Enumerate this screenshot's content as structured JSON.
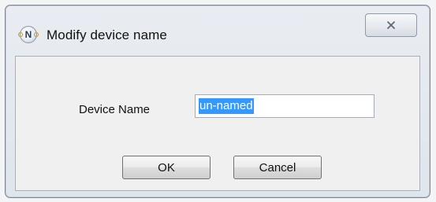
{
  "window": {
    "title": "Modify device name",
    "app_icon": "n-icon",
    "app_icon_letter": "N",
    "close_icon": "close-icon"
  },
  "form": {
    "device_name_label": "Device Name",
    "device_name_value": "un-named"
  },
  "buttons": {
    "ok_label": "OK",
    "cancel_label": "Cancel"
  },
  "colors": {
    "selection": "#3399ff",
    "selection_text": "#ffffff"
  }
}
